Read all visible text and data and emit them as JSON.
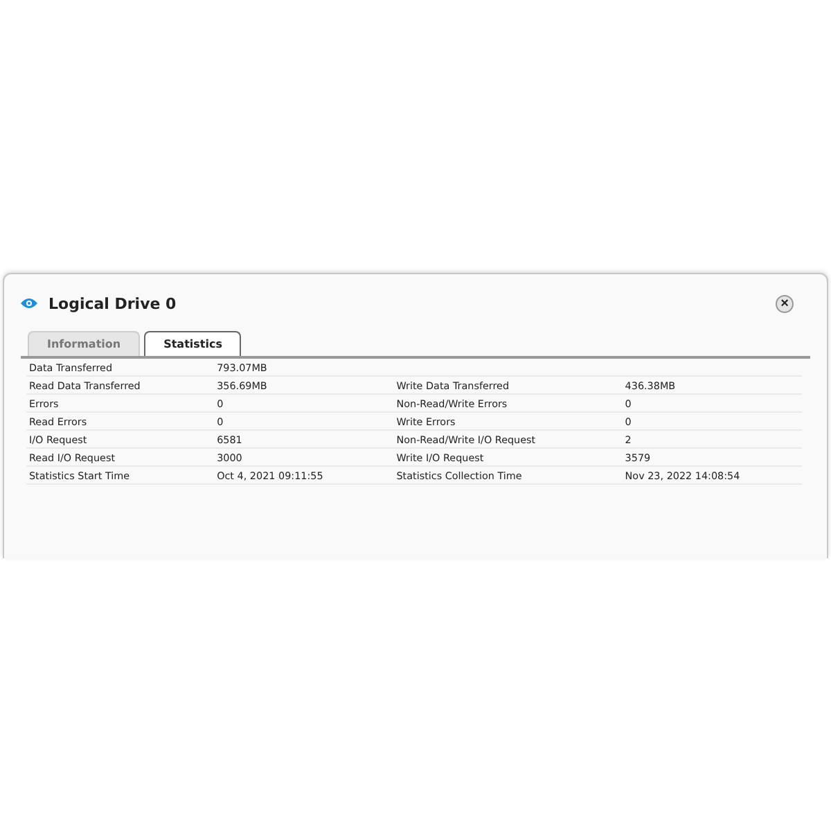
{
  "dialog": {
    "title": "Logical Drive 0",
    "close": "×"
  },
  "tabs": [
    {
      "label": "Information",
      "selected": false
    },
    {
      "label": "Statistics",
      "selected": true
    }
  ],
  "rows": [
    {
      "label": "Data Transferred",
      "value": "793.07MB"
    },
    {
      "label": "Read Data Transferred",
      "value": "356.69MB",
      "label_2": "Write Data Transferred",
      "value_2": "436.38MB"
    },
    {
      "label": "Errors",
      "value": "0",
      "label_2": "Non-Read/Write Errors",
      "value_2": "0"
    },
    {
      "label": "Read Errors",
      "value": "0",
      "label_2": "Write Errors",
      "value_2": "0"
    },
    {
      "label": "I/O Request",
      "value": "6581",
      "label_2": "Non-Read/Write I/O Request",
      "value_2": "2"
    },
    {
      "label": "Read I/O Request",
      "value": "3000",
      "label_2": "Write I/O Request",
      "value_2": "3579"
    },
    {
      "label": "Statistics Start Time",
      "value": "Oct 4, 2021 09:11:55",
      "label_2": "Statistics Collection Time",
      "value_2": "Nov 23, 2022 14:08:54"
    }
  ]
}
